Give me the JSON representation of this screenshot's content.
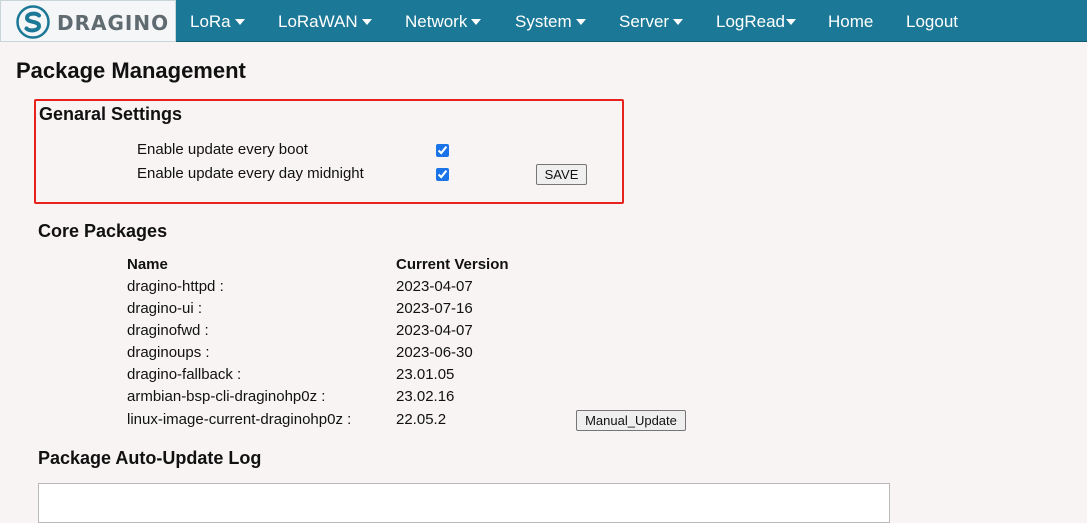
{
  "brand": {
    "logo_text": "DRAGINO",
    "logo_icon": "dragino-s-logo-icon",
    "colors": {
      "navbar": "#1b7896",
      "highlight": "#e8211c",
      "logo_text": "#5f6b70"
    }
  },
  "nav": {
    "items": [
      {
        "label": "LoRa",
        "has_dropdown": true
      },
      {
        "label": "LoRaWAN",
        "has_dropdown": true
      },
      {
        "label": "Network",
        "has_dropdown": true
      },
      {
        "label": "System",
        "has_dropdown": true
      },
      {
        "label": "Server",
        "has_dropdown": true
      },
      {
        "label": "LogRead",
        "has_dropdown": true
      },
      {
        "label": "Home",
        "has_dropdown": false
      },
      {
        "label": "Logout",
        "has_dropdown": false
      }
    ]
  },
  "page": {
    "title": "Package Management"
  },
  "general_settings": {
    "title": "Genaral Settings",
    "update_every_boot_label": "Enable update every boot",
    "update_every_boot_checked": true,
    "update_every_midnight_label": "Enable update every day midnight",
    "update_every_midnight_checked": true,
    "save_label": "SAVE"
  },
  "core_packages": {
    "title": "Core Packages",
    "headers": {
      "name": "Name",
      "version": "Current Version"
    },
    "rows": [
      {
        "name": "dragino-httpd :",
        "version": "2023-04-07"
      },
      {
        "name": "dragino-ui :",
        "version": "2023-07-16"
      },
      {
        "name": "draginofwd :",
        "version": "2023-04-07"
      },
      {
        "name": "draginoups :",
        "version": "2023-06-30"
      },
      {
        "name": "dragino-fallback :",
        "version": "23.01.05"
      },
      {
        "name": "armbian-bsp-cli-draginohp0z :",
        "version": "23.02.16"
      },
      {
        "name": "linux-image-current-draginohp0z :",
        "version": "22.05.2"
      }
    ],
    "manual_update_label": "Manual_Update"
  },
  "auto_update_log": {
    "title": "Package Auto-Update Log"
  }
}
